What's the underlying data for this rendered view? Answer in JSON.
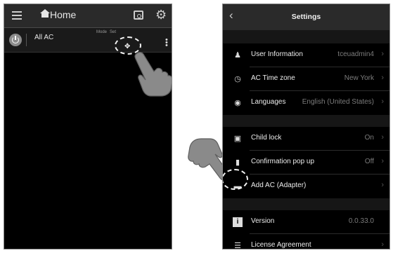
{
  "left": {
    "home_title": "Home",
    "ac_row": {
      "name": "All AC",
      "mode_label": "Mode",
      "set_label": "Set"
    }
  },
  "right": {
    "title": "Settings",
    "items": [
      {
        "icon": "person-icon",
        "label": "User Information",
        "value": "tceuadmin4"
      },
      {
        "icon": "clock-icon",
        "label": "AC Time zone",
        "value": "New York"
      },
      {
        "icon": "globe-icon",
        "label": "Languages",
        "value": "English (United States)"
      },
      {
        "icon": "lock-icon",
        "label": "Child lock",
        "value": "On"
      },
      {
        "icon": "chat-bubble-icon",
        "label": "Confirmation pop up",
        "value": "Off"
      },
      {
        "icon": "adapter-icon",
        "label": "Add AC (Adapter)",
        "value": ""
      },
      {
        "icon": "info-icon",
        "label": "Version",
        "value": "0.0.33.0"
      },
      {
        "icon": "document-icon",
        "label": "License Agreement",
        "value": ""
      }
    ]
  }
}
